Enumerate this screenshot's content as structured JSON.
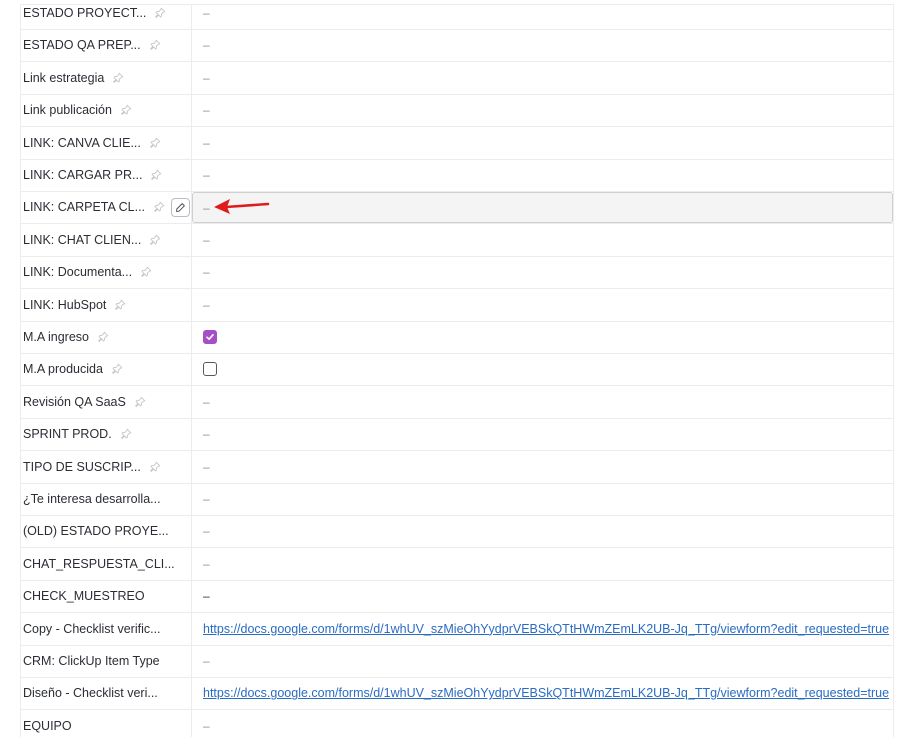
{
  "colors": {
    "accent_checkbox": "#a54fc4",
    "link": "#2a6cc4",
    "arrow": "#e01b1b"
  },
  "fields": [
    {
      "name": "ESTADO PROYECT...",
      "pin": true,
      "value": "–",
      "type": "empty"
    },
    {
      "name": "ESTADO QA PREP...",
      "pin": true,
      "value": "–",
      "type": "empty"
    },
    {
      "name": "Link estrategia",
      "pin": true,
      "value": "–",
      "type": "empty"
    },
    {
      "name": "Link publicación",
      "pin": true,
      "value": "–",
      "type": "empty"
    },
    {
      "name": "LINK: CANVA CLIE...",
      "pin": true,
      "value": "–",
      "type": "empty"
    },
    {
      "name": "LINK: CARGAR PR...",
      "pin": true,
      "value": "–",
      "type": "empty"
    },
    {
      "name": "LINK: CARPETA CL...",
      "pin": true,
      "edit": true,
      "highlight": true,
      "value": "–",
      "type": "empty"
    },
    {
      "name": "LINK: CHAT CLIEN...",
      "pin": true,
      "value": "–",
      "type": "empty"
    },
    {
      "name": "LINK: Documenta...",
      "pin": true,
      "value": "–",
      "type": "empty"
    },
    {
      "name": "LINK: HubSpot",
      "pin": true,
      "value": "–",
      "type": "empty"
    },
    {
      "name": "M.A ingreso",
      "pin": true,
      "value": true,
      "type": "checkbox"
    },
    {
      "name": "M.A producida",
      "pin": true,
      "value": false,
      "type": "checkbox"
    },
    {
      "name": "Revisión QA SaaS",
      "pin": true,
      "value": "–",
      "type": "empty"
    },
    {
      "name": "SPRINT PROD.",
      "pin": true,
      "value": "–",
      "type": "empty"
    },
    {
      "name": "TIPO DE SUSCRIP...",
      "pin": true,
      "value": "–",
      "type": "empty"
    },
    {
      "name": "¿Te interesa desarrolla...",
      "pin": false,
      "value": "–",
      "type": "empty"
    },
    {
      "name": "(OLD) ESTADO PROYE...",
      "pin": false,
      "value": "–",
      "type": "empty"
    },
    {
      "name": "CHAT_RESPUESTA_CLI...",
      "pin": false,
      "value": "–",
      "type": "empty"
    },
    {
      "name": "CHECK_MUESTREO",
      "pin": false,
      "value": "–",
      "type": "empty-dark"
    },
    {
      "name": "Copy - Checklist verific...",
      "pin": false,
      "value": "https://docs.google.com/forms/d/1whUV_szMieOhYydprVEBSkQTtHWmZEmLK2UB-Jq_TTg/viewform?edit_requested=true",
      "type": "link"
    },
    {
      "name": "CRM: ClickUp Item Type",
      "pin": false,
      "value": "–",
      "type": "empty"
    },
    {
      "name": "Diseño - Checklist veri...",
      "pin": false,
      "value": "https://docs.google.com/forms/d/1whUV_szMieOhYydprVEBSkQTtHWmZEmLK2UB-Jq_TTg/viewform?edit_requested=true",
      "type": "link"
    },
    {
      "name": "EQUIPO",
      "pin": false,
      "value": "–",
      "type": "empty"
    }
  ]
}
